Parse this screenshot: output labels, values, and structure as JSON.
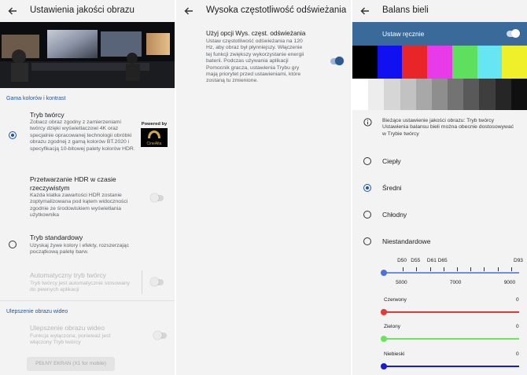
{
  "panel1": {
    "title": "Ustawienia jakości obrazu",
    "section_gamut": "Gama kolorów i kontrast",
    "creator_mode": {
      "title": "Tryb twórcy",
      "desc": "Zobacz obraz zgodny z zamierzeniami twórcy dzięki wyświetlaczowi 4K oraz specjalnie opracowanej technologii obróbki obrazu zgodnej z gamą kolorów BT.2020 i specyfikacją 10-bitowej palety kolorów HDR.",
      "selected": true,
      "badge_top": "Powered by",
      "badge_logo": "CineAlta"
    },
    "hdr_realtime": {
      "title": "Przetwarzanie HDR w czasie rzeczywistym",
      "desc": "Każda klatka zawartości HDR zostanie zoptymalizowana pod kątem widoczności zgodnie ze środowiskiem wyświetlania użytkownika",
      "enabled": false
    },
    "standard_mode": {
      "title": "Tryb standardowy",
      "desc": "Uzyskaj żywe kolory i efekty, rozszerzając początkową paletę barw.",
      "selected": false
    },
    "auto_creator": {
      "title": "Automatyczny tryb twórcy",
      "desc": "Tryb twórcy jest automatycznie stosowany do pewnych aplikacji",
      "enabled": false
    },
    "section_video": "Ulepszenie obrazu wideo",
    "video_enhance": {
      "title": "Ulepszenie obrazu wideo",
      "desc": "Funkcja wyłączona, ponieważ jest włączony Tryb twórcy",
      "enabled": false
    },
    "fullscreen_button": "PEŁNY EKRAN (X1 for mobile)"
  },
  "panel2": {
    "title": "Wysoka częstotliwość odświeżania",
    "option_title": "Użyj opcji Wys. częst. odświeżania",
    "option_desc": "Ustaw częstotliwość odświeżania na 120 Hz, aby obraz był płynniejszy. Włączenie tej funkcji zwiększy wykorzystanie energii baterii. Podczas używania aplikacji Pomocnik gracza, ustawienia Trybu gry mają priorytet przed ustawieniami, które zostaną tu zmienione.",
    "enabled": true
  },
  "panel3": {
    "title": "Balans bieli",
    "manual_label": "Ustaw ręcznie",
    "manual_enabled": true,
    "info_text": "Bieżące ustawienie jakości obrazu: Tryb twórcy Ustawienia balansu bieli można obecnie dostosowywać w Trybie twórcy",
    "options": [
      {
        "label": "Ciepły",
        "selected": false
      },
      {
        "label": "Średni",
        "selected": true
      },
      {
        "label": "Chłodny",
        "selected": false
      },
      {
        "label": "Niestandardowe",
        "selected": false
      }
    ],
    "temp_presets": [
      "D50",
      "D55",
      "D61",
      "D65",
      "D93"
    ],
    "temp_scale": [
      "5000",
      "7000",
      "9000"
    ],
    "temp_value": 4300,
    "rgb": [
      {
        "label": "Czerwony",
        "value": "0",
        "color": "#e53935"
      },
      {
        "label": "Zielony",
        "value": "0",
        "color": "#6be35a"
      },
      {
        "label": "Niebieski",
        "value": "0",
        "color": "#1a1ad6"
      }
    ],
    "color_swatches": [
      "#000000",
      "#1010f0",
      "#e8262a",
      "#e83ae8",
      "#5ee05e",
      "#66e6f2",
      "#f0f02a"
    ],
    "gray_ramp": [
      "#ffffff",
      "#ededed",
      "#d6d6d6",
      "#c2c2c2",
      "#a8a8a8",
      "#8e8e8e",
      "#737373",
      "#595959",
      "#3e3e3e",
      "#262626",
      "#101010"
    ]
  },
  "colors": {
    "accent": "#1a57a8",
    "header_bar": "#3a6a9a",
    "panel_bg": "#f3f3f3"
  }
}
